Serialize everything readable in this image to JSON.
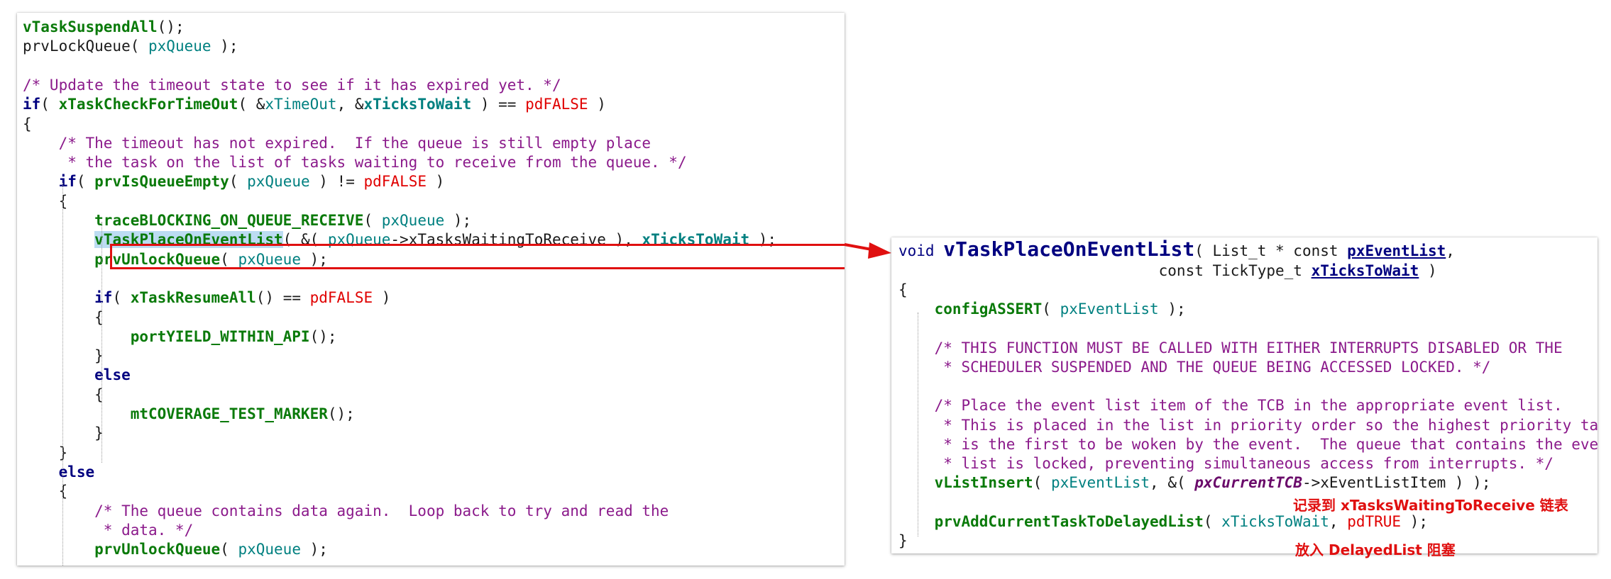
{
  "left_code": {
    "lines": [
      [
        [
          "func",
          "vTaskSuspendAll"
        ],
        [
          "plain",
          "();"
        ]
      ],
      [
        [
          "plain",
          "prvLockQueue( "
        ],
        [
          "var",
          "pxQueue"
        ],
        [
          "plain",
          " );"
        ]
      ],
      [],
      [
        [
          "comment",
          "/* Update the timeout state to see if it has expired yet. */"
        ]
      ],
      [
        [
          "kw",
          "if"
        ],
        [
          "plain",
          "( "
        ],
        [
          "func",
          "xTaskCheckForTimeOut"
        ],
        [
          "plain",
          "( &"
        ],
        [
          "var",
          "xTimeOut"
        ],
        [
          "plain",
          ", &"
        ],
        [
          "bvar",
          "xTicksToWait"
        ],
        [
          "plain",
          " ) == "
        ],
        [
          "red",
          "pdFALSE"
        ],
        [
          "plain",
          " )"
        ]
      ],
      [
        [
          "plain",
          "{"
        ]
      ],
      [
        [
          "comment",
          "    /* The timeout has not expired.  If the queue is still empty place"
        ]
      ],
      [
        [
          "comment",
          "     * the task on the list of tasks waiting to receive from the queue. */"
        ]
      ],
      [
        [
          "plain",
          "    "
        ],
        [
          "kw",
          "if"
        ],
        [
          "plain",
          "( "
        ],
        [
          "func",
          "prvIsQueueEmpty"
        ],
        [
          "plain",
          "( "
        ],
        [
          "var",
          "pxQueue"
        ],
        [
          "plain",
          " ) != "
        ],
        [
          "red",
          "pdFALSE"
        ],
        [
          "plain",
          " )"
        ]
      ],
      [
        [
          "plain",
          "    {"
        ]
      ],
      [
        [
          "plain",
          "        "
        ],
        [
          "func",
          "traceBLOCKING_ON_QUEUE_RECEIVE"
        ],
        [
          "plain",
          "( "
        ],
        [
          "var",
          "pxQueue"
        ],
        [
          "plain",
          " );"
        ]
      ],
      [
        [
          "plain",
          "        "
        ],
        [
          "hl",
          "vTaskPlaceOnEventList"
        ],
        [
          "plain",
          "( &( "
        ],
        [
          "var",
          "pxQueue"
        ],
        [
          "plain",
          "->xTasksWaitingToReceive ), "
        ],
        [
          "bvar",
          "xTicksToWait"
        ],
        [
          "plain",
          " );"
        ]
      ],
      [
        [
          "plain",
          "        "
        ],
        [
          "func",
          "prvUnlockQueue"
        ],
        [
          "plain",
          "( "
        ],
        [
          "var",
          "pxQueue"
        ],
        [
          "plain",
          " );"
        ]
      ],
      [],
      [
        [
          "plain",
          "        "
        ],
        [
          "kw",
          "if"
        ],
        [
          "plain",
          "( "
        ],
        [
          "func",
          "xTaskResumeAll"
        ],
        [
          "plain",
          "() == "
        ],
        [
          "red",
          "pdFALSE"
        ],
        [
          "plain",
          " )"
        ]
      ],
      [
        [
          "plain",
          "        {"
        ]
      ],
      [
        [
          "plain",
          "            "
        ],
        [
          "func",
          "portYIELD_WITHIN_API"
        ],
        [
          "plain",
          "();"
        ]
      ],
      [
        [
          "plain",
          "        }"
        ]
      ],
      [
        [
          "plain",
          "        "
        ],
        [
          "kw",
          "else"
        ]
      ],
      [
        [
          "plain",
          "        {"
        ]
      ],
      [
        [
          "plain",
          "            "
        ],
        [
          "func",
          "mtCOVERAGE_TEST_MARKER"
        ],
        [
          "plain",
          "();"
        ]
      ],
      [
        [
          "plain",
          "        }"
        ]
      ],
      [
        [
          "plain",
          "    }"
        ]
      ],
      [
        [
          "plain",
          "    "
        ],
        [
          "kw",
          "else"
        ]
      ],
      [
        [
          "plain",
          "    {"
        ]
      ],
      [
        [
          "comment",
          "        /* The queue contains data again.  Loop back to try and read the"
        ]
      ],
      [
        [
          "comment",
          "         * data. */"
        ]
      ],
      [
        [
          "plain",
          "        "
        ],
        [
          "func",
          "prvUnlockQueue"
        ],
        [
          "plain",
          "( "
        ],
        [
          "var",
          "pxQueue"
        ],
        [
          "plain",
          " );"
        ]
      ]
    ]
  },
  "right_code": {
    "lines": [
      [
        [
          "kwplain",
          "void "
        ],
        [
          "bigfunc",
          "vTaskPlaceOnEventList"
        ],
        [
          "plain",
          "( List_t * const "
        ],
        [
          "param",
          "pxEventList"
        ],
        [
          "plain",
          ","
        ]
      ],
      [
        [
          "plain",
          "                             const TickType_t "
        ],
        [
          "param",
          "xTicksToWait"
        ],
        [
          "plain",
          " )"
        ]
      ],
      [
        [
          "plain",
          "{"
        ]
      ],
      [
        [
          "plain",
          "    "
        ],
        [
          "func",
          "configASSERT"
        ],
        [
          "plain",
          "( "
        ],
        [
          "var",
          "pxEventList"
        ],
        [
          "plain",
          " );"
        ]
      ],
      [],
      [
        [
          "comment",
          "    /* THIS FUNCTION MUST BE CALLED WITH EITHER INTERRUPTS DISABLED OR THE"
        ]
      ],
      [
        [
          "comment",
          "     * SCHEDULER SUSPENDED AND THE QUEUE BEING ACCESSED LOCKED. */"
        ]
      ],
      [],
      [
        [
          "comment",
          "    /* Place the event list item of the TCB in the appropriate event list."
        ]
      ],
      [
        [
          "comment",
          "     * This is placed in the list in priority order so the highest priority task"
        ]
      ],
      [
        [
          "comment",
          "     * is the first to be woken by the event.  The queue that contains the event"
        ]
      ],
      [
        [
          "comment",
          "     * list is locked, preventing simultaneous access from interrupts. */"
        ]
      ],
      [
        [
          "plain",
          "    "
        ],
        [
          "func",
          "vListInsert"
        ],
        [
          "plain",
          "( "
        ],
        [
          "var",
          "pxEventList"
        ],
        [
          "plain",
          ", &( "
        ],
        [
          "ptr",
          "pxCurrentTCB"
        ],
        [
          "plain",
          "->xEventListItem ) );"
        ]
      ],
      [],
      [
        [
          "plain",
          "    "
        ],
        [
          "func",
          "prvAddCurrentTaskToDelayedList"
        ],
        [
          "plain",
          "( "
        ],
        [
          "var",
          "xTicksToWait"
        ],
        [
          "plain",
          ", "
        ],
        [
          "red",
          "pdTRUE"
        ],
        [
          "plain",
          " );"
        ]
      ],
      [
        [
          "plain",
          "}"
        ]
      ]
    ]
  },
  "annotations": {
    "insert_note": "记录到 xTasksWaitingToReceive 链表",
    "delay_note": "放入 DelayedList 阻塞"
  },
  "colors": {
    "callout": "#e01010",
    "highlight": "#bcdcf2",
    "comment": "#8b1a8b",
    "keyword": "#000080",
    "function": "#0a7a0a",
    "variable": "#008080",
    "constant": "#e00000"
  }
}
